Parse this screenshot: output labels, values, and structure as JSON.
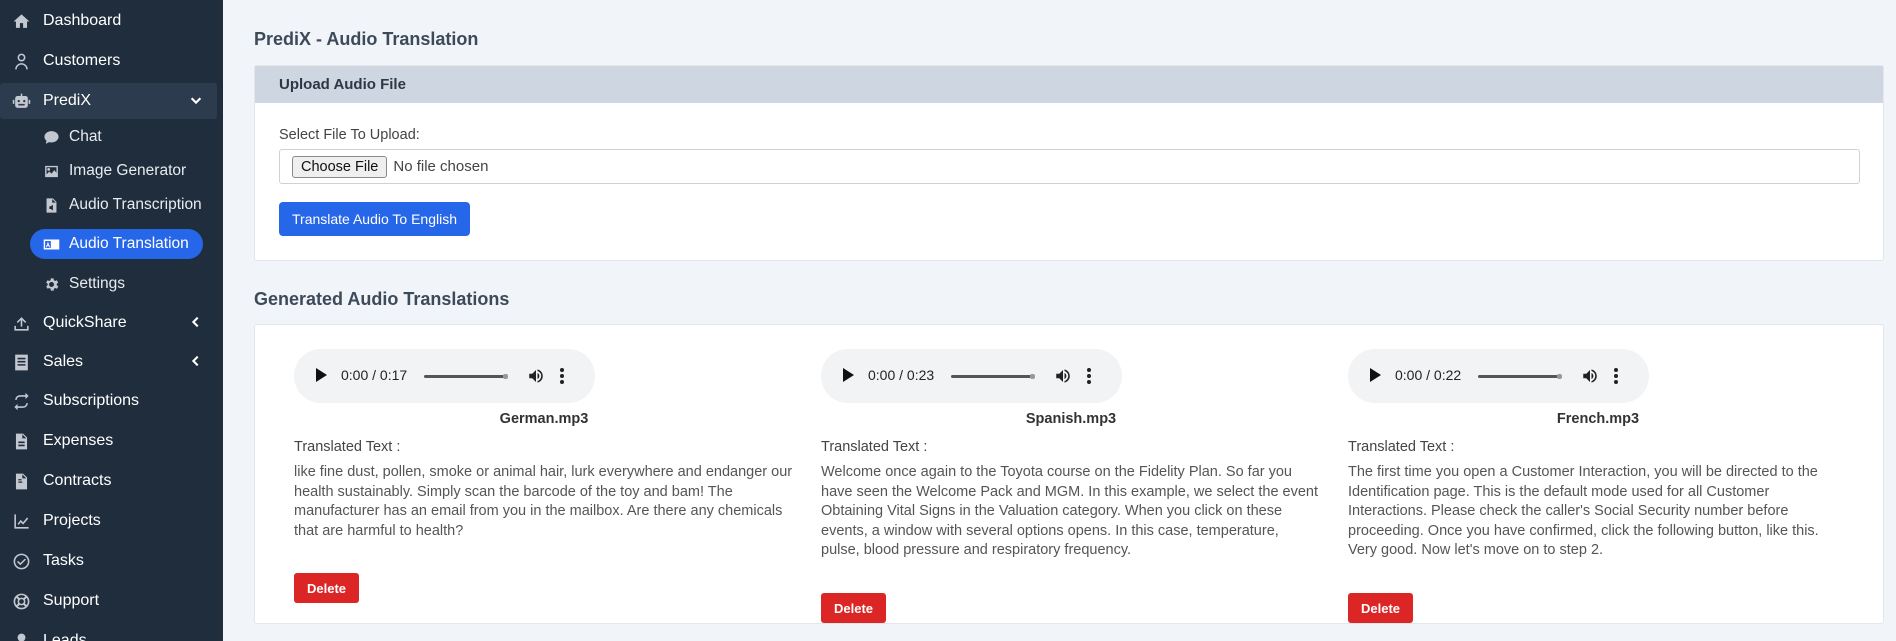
{
  "sidebar": {
    "items": [
      {
        "label": "Dashboard",
        "icon": "home-icon"
      },
      {
        "label": "Customers",
        "icon": "user-icon"
      },
      {
        "label": "PrediX",
        "icon": "robot-icon"
      },
      {
        "label": "QuickShare",
        "icon": "upload-icon"
      },
      {
        "label": "Sales",
        "icon": "receipt-icon"
      },
      {
        "label": "Subscriptions",
        "icon": "repeat-icon"
      },
      {
        "label": "Expenses",
        "icon": "invoice-icon"
      },
      {
        "label": "Contracts",
        "icon": "file-contract-icon"
      },
      {
        "label": "Projects",
        "icon": "chart-line-icon"
      },
      {
        "label": "Tasks",
        "icon": "check-circle-icon"
      },
      {
        "label": "Support",
        "icon": "life-ring-icon"
      },
      {
        "label": "Leads",
        "icon": "leads-icon"
      }
    ],
    "predix_sub": [
      {
        "label": "Chat",
        "icon": "comment-icon"
      },
      {
        "label": "Image Generator",
        "icon": "image-icon"
      },
      {
        "label": "Audio Transcription",
        "icon": "file-audio-icon"
      },
      {
        "label": "Audio Translation",
        "icon": "language-icon"
      },
      {
        "label": "Settings",
        "icon": "gear-icon"
      }
    ]
  },
  "page": {
    "title": "PrediX - Audio Translation",
    "upload_header": "Upload Audio File",
    "file_label": "Select File To Upload:",
    "choose_file": "Choose File",
    "no_file": "No file chosen",
    "translate_button": "Translate Audio To English",
    "section_title": "Generated Audio Translations"
  },
  "translations": [
    {
      "time": "0:00 / 0:17",
      "filename": "German.mp3",
      "label": "Translated Text :",
      "text": "like fine dust, pollen, smoke or animal hair, lurk everywhere and endanger our health sustainably. Simply scan the barcode of the toy and bam! The manufacturer has an email from you in the mailbox. Are there any chemicals that are harmful to health?",
      "delete": "Delete"
    },
    {
      "time": "0:00 / 0:23",
      "filename": "Spanish.mp3",
      "label": "Translated Text :",
      "text": "Welcome once again to the Toyota course on the Fidelity Plan. So far you have seen the Welcome Pack and MGM. In this example, we select the event Obtaining Vital Signs in the Valuation category. When you click on these events, a window with several options opens. In this case, temperature, pulse, blood pressure and respiratory frequency.",
      "delete": "Delete"
    },
    {
      "time": "0:00 / 0:22",
      "filename": "French.mp3",
      "label": "Translated Text :",
      "text": "The first time you open a Customer Interaction, you will be directed to the Identification page. This is the default mode used for all Customer Interactions. Please check the caller's Social Security number before proceeding. Once you have confirmed, click the following button, like this. Very good. Now let's move on to step 2.",
      "delete": "Delete"
    }
  ],
  "colors": {
    "sidebar_bg": "#1f2d3d",
    "accent": "#2666e8",
    "danger": "#dc2626",
    "card_header": "#cdd6e1"
  }
}
